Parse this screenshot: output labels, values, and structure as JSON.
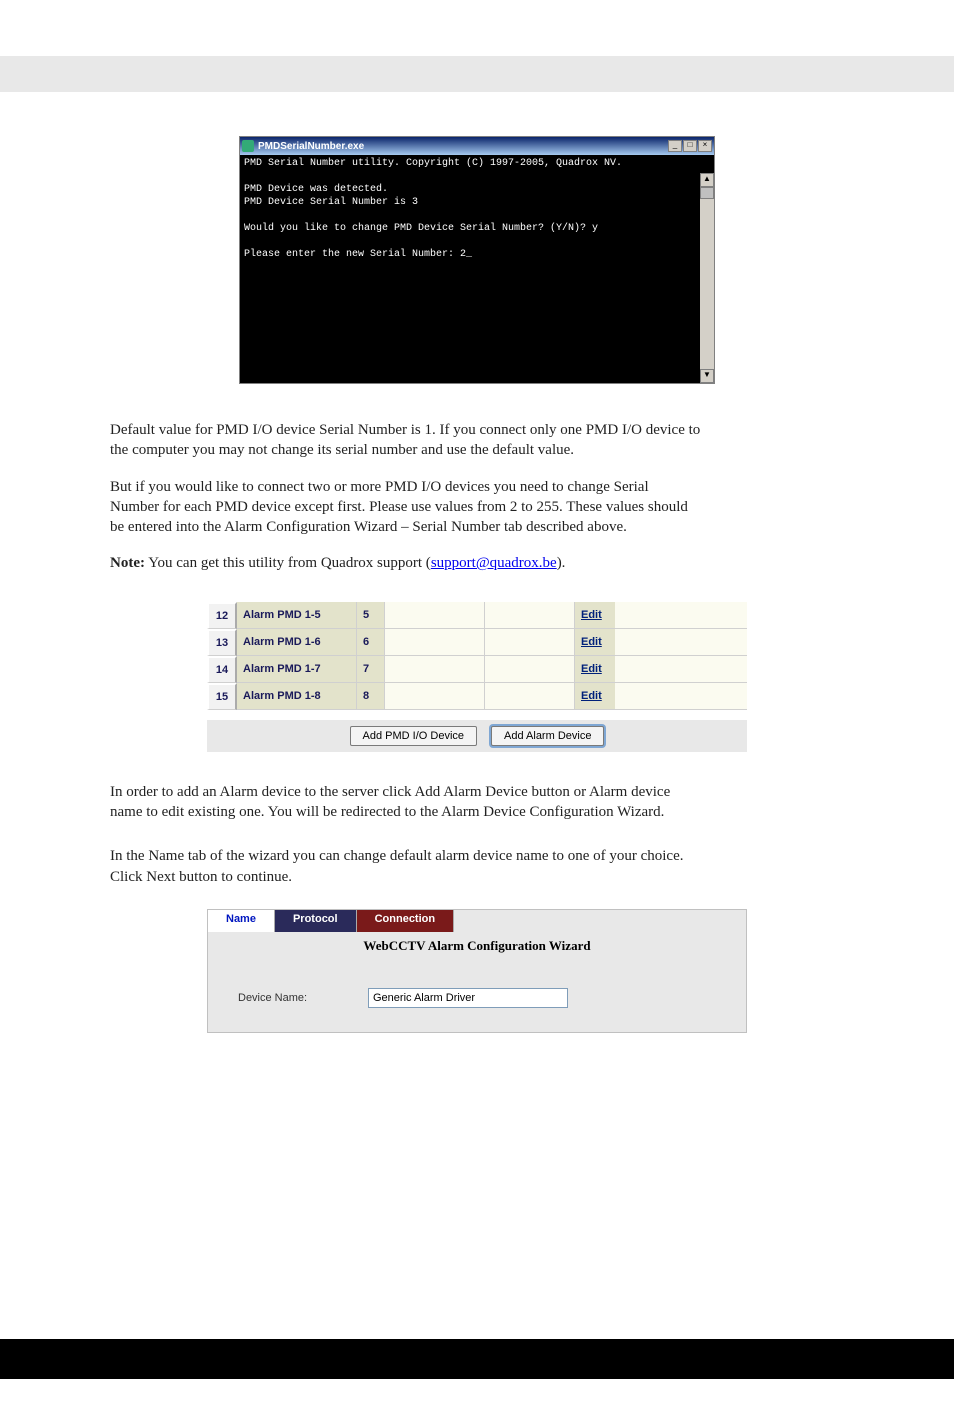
{
  "terminal": {
    "title": "PMDSerialNumber.exe",
    "lines": "PMD Serial Number utility. Copyright (C) 1997-2005, Quadrox NV.\n\nPMD Device was detected.\nPMD Device Serial Number is 3\n\nWould you like to change PMD Device Serial Number? (Y/N)? y\n\nPlease enter the new Serial Number: 2_"
  },
  "para1": {
    "l1": "Default value for PMD I/O device Serial Number is 1. If you connect only one PMD I/O device to",
    "l2": "the computer you may not change its serial number and use the default value.",
    "l3": "But if you would like to connect two or more PMD I/O devices you need to change Serial",
    "l4": "Number for each PMD device except first. Please use values from 2 to 255. These values should",
    "l5": "be entered into the Alarm Configuration Wizard – Serial Number tab described above.",
    "note_lead": "Note:",
    "note_text": "You can get this utility from Quadrox support (",
    "note_link": "support@quadrox.be",
    "note_tail": ")."
  },
  "pmd_rows": [
    {
      "idx": "12",
      "name": "Alarm PMD 1-5",
      "num": "5",
      "edit": "Edit"
    },
    {
      "idx": "13",
      "name": "Alarm PMD 1-6",
      "num": "6",
      "edit": "Edit"
    },
    {
      "idx": "14",
      "name": "Alarm PMD 1-7",
      "num": "7",
      "edit": "Edit"
    },
    {
      "idx": "15",
      "name": "Alarm PMD 1-8",
      "num": "8",
      "edit": "Edit"
    }
  ],
  "buttons": {
    "add_pmd": "Add PMD I/O Device",
    "add_alarm": "Add Alarm Device"
  },
  "para2": {
    "l1": "In order to add an Alarm device to the server click Add Alarm Device button or Alarm device",
    "l2": "name to edit existing one. You will be redirected to the Alarm Device Configuration Wizard.",
    "l3": "In the Name tab of the wizard you can change default alarm device name to one of your choice.",
    "l4": "Click Next button to continue."
  },
  "wizard": {
    "tab_name": "Name",
    "tab_protocol": "Protocol",
    "tab_connection": "Connection",
    "title": "WebCCTV Alarm Configuration Wizard",
    "label": "Device Name:",
    "value": "Generic Alarm Driver"
  }
}
